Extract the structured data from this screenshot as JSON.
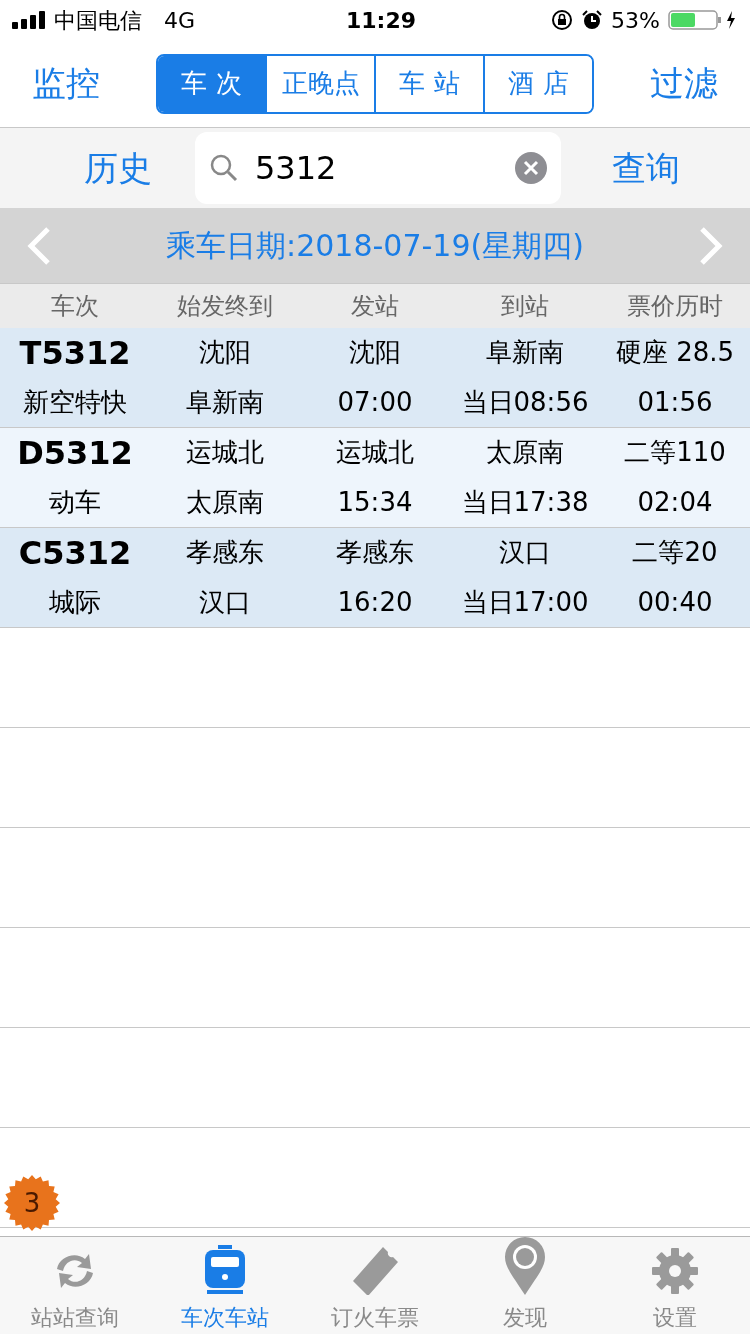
{
  "status_bar": {
    "carrier": "中国电信",
    "network": "4G",
    "time": "11:29",
    "battery": "53%"
  },
  "nav": {
    "left": "监控",
    "right": "过滤",
    "tabs": [
      {
        "label": "车 次",
        "selected": true
      },
      {
        "label": "正晚点",
        "selected": false
      },
      {
        "label": "车 站",
        "selected": false
      },
      {
        "label": "酒 店",
        "selected": false
      }
    ]
  },
  "search": {
    "history": "历史",
    "value": "5312",
    "submit": "查询"
  },
  "date_bar": {
    "label": "乘车日期:2018-07-19(星期四)"
  },
  "table": {
    "columns": [
      "车次",
      "始发终到",
      "发站",
      "到站",
      "票价历时"
    ],
    "rows": [
      {
        "train": "T5312",
        "type": "新空特快",
        "origin": "沈阳",
        "terminus": "阜新南",
        "depart_station": "沈阳",
        "depart_time": "07:00",
        "arrive_station": "阜新南",
        "arrive_time": "当日08:56",
        "price": "硬座 28.5",
        "duration": "01:56"
      },
      {
        "train": "D5312",
        "type": "动车",
        "origin": "运城北",
        "terminus": "太原南",
        "depart_station": "运城北",
        "depart_time": "15:34",
        "arrive_station": "太原南",
        "arrive_time": "当日17:38",
        "price": "二等110",
        "duration": "02:04"
      },
      {
        "train": "C5312",
        "type": "城际",
        "origin": "孝感东",
        "terminus": "汉口",
        "depart_station": "孝感东",
        "depart_time": "16:20",
        "arrive_station": "汉口",
        "arrive_time": "当日17:00",
        "price": "二等20",
        "duration": "00:40"
      }
    ]
  },
  "badge": "3",
  "tab_bar": [
    {
      "kind": "refresh",
      "label": "站站查询",
      "selected": false
    },
    {
      "kind": "train",
      "label": "车次车站",
      "selected": true
    },
    {
      "kind": "ticket",
      "label": "订火车票",
      "selected": false
    },
    {
      "kind": "pin",
      "label": "发现",
      "selected": false
    },
    {
      "kind": "gear",
      "label": "设置",
      "selected": false
    }
  ]
}
